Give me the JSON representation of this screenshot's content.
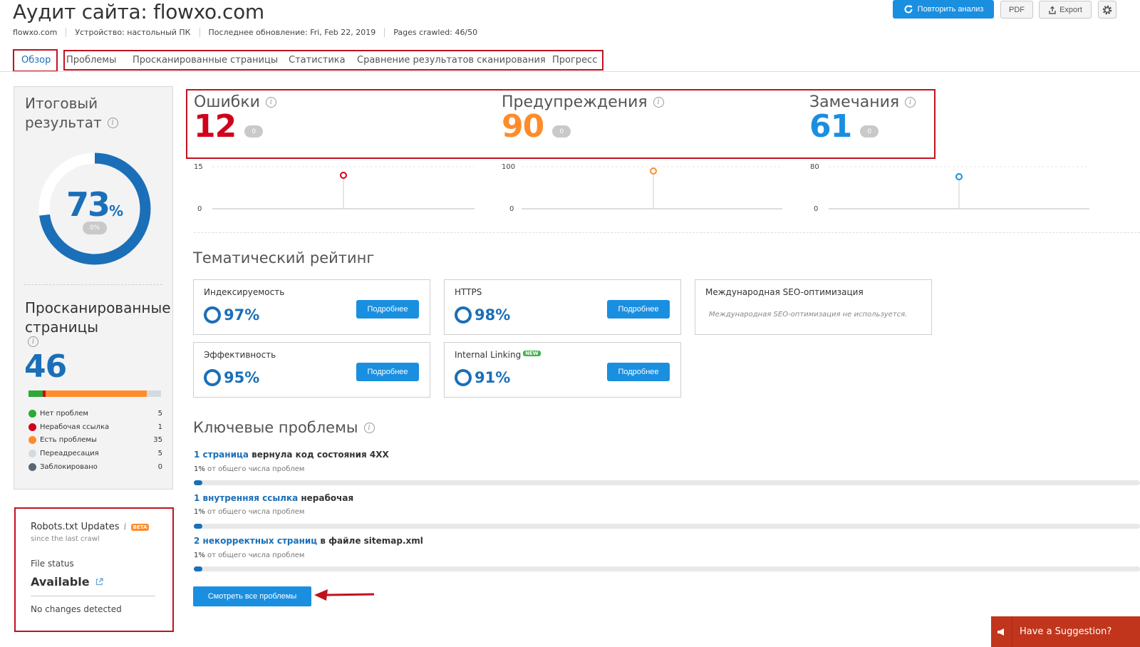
{
  "header": {
    "title_prefix": "Аудит сайта: ",
    "title_domain": "flowxo.com",
    "meta": [
      "flowxo.com",
      "Устройство: настольный ПК",
      "Последнее обновление: Fri, Feb 22, 2019",
      "Pages crawled: 46/50"
    ],
    "rerun_label": "Повторить анализ",
    "pdf_label": "PDF",
    "export_label": "Export"
  },
  "tabs": [
    "Обзор",
    "Проблемы",
    "Просканированные страницы",
    "Статистика",
    "Сравнение результатов сканирования",
    "Прогресс"
  ],
  "total_score": {
    "title_line1": "Итоговый",
    "title_line2": "результат",
    "value": "73",
    "unit": "%",
    "delta": "0%",
    "fraction": 0.73
  },
  "crawled": {
    "title_line1": "Просканированные",
    "title_line2": "страницы",
    "count": "46",
    "legend": [
      {
        "label": "Нет проблем",
        "count": "5",
        "color": "#2ea836"
      },
      {
        "label": "Нерабочая ссылка",
        "count": "1",
        "color": "#d0021b"
      },
      {
        "label": "Есть проблемы",
        "count": "35",
        "color": "#ff8c2a"
      },
      {
        "label": "Переадресация",
        "count": "5",
        "color": "#d3dbe0"
      },
      {
        "label": "Заблокировано",
        "count": "0",
        "color": "#5a6670"
      }
    ]
  },
  "stats": [
    {
      "title": "Ошибки",
      "value": "12",
      "delta": "0",
      "color": "#d0021b",
      "axis_max": "15",
      "axis_min": "0"
    },
    {
      "title": "Предупреждения",
      "value": "90",
      "delta": "0",
      "color": "#ff8c2a",
      "axis_max": "100",
      "axis_min": "0"
    },
    {
      "title": "Замечания",
      "value": "61",
      "delta": "0",
      "color": "#1a8fe0",
      "axis_max": "80",
      "axis_min": "0"
    }
  ],
  "thematic": {
    "title": "Тематический рейтинг",
    "details_label": "Подробнее",
    "cards": [
      {
        "title": "Индексируемость",
        "value": "97%"
      },
      {
        "title": "HTTPS",
        "value": "98%"
      },
      {
        "title": "Международная SEO-оптимизация",
        "note": "Международная SEO-оптимизация не используется."
      },
      {
        "title": "Эффективность",
        "value": "95%"
      },
      {
        "title": "Internal Linking",
        "badge": "NEW",
        "value": "91%"
      }
    ]
  },
  "key_issues": {
    "title": "Ключевые проблемы",
    "items": [
      {
        "link": "1 страница",
        "rest": " вернула код состояния 4XX",
        "pct": "1%",
        "sub": " от общего числа проблем",
        "fraction": 0.01
      },
      {
        "link": "1 внутренняя ссылка",
        "rest": " нерабочая",
        "pct": "1%",
        "sub": " от общего числа проблем",
        "fraction": 0.01
      },
      {
        "link": "2 некорректных страниц",
        "rest": " в файле sitemap.xml",
        "pct": "1%",
        "sub": " от общего числа проблем",
        "fraction": 0.01
      }
    ],
    "view_all_label": "Смотреть все проблемы"
  },
  "robots": {
    "title": "Robots.txt Updates",
    "badge": "BETA",
    "subtitle": "since the last crawl",
    "status_label": "File status",
    "status_value": "Available",
    "changes": "No changes detected"
  },
  "suggestion": {
    "label": "Have a Suggestion?"
  }
}
